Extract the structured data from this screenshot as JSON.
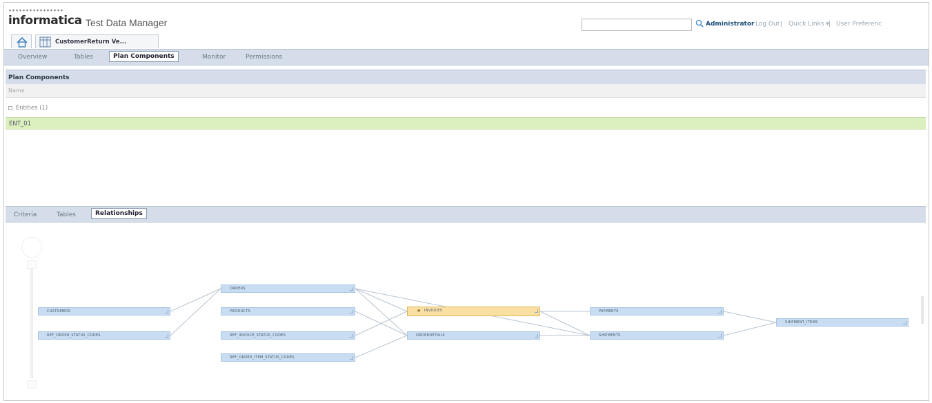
{
  "header": {
    "logo_text": "informatica",
    "product_name": "Test Data Manager",
    "search": {
      "value": "",
      "placeholder": ""
    },
    "user": "Administrator",
    "links": [
      "Log Out",
      "|",
      "Quick Links ▾",
      "|",
      "User Preferenc"
    ]
  },
  "object_tabs": {
    "home_icon": "home-icon",
    "document_tab": {
      "icon": "table-icon",
      "label": "CustomerReturn Ve..."
    }
  },
  "nav": {
    "tabs": [
      {
        "label": "Overview",
        "active": false
      },
      {
        "label": "Tables",
        "active": false
      },
      {
        "label": "Plan Components",
        "active": true
      },
      {
        "label": "Monitor",
        "active": false
      },
      {
        "label": "Permissions",
        "active": false
      }
    ]
  },
  "plan_components": {
    "title": "Plan Components",
    "column_header": "Name",
    "group_label": "Entities (1)",
    "rows": [
      "ENT_01"
    ]
  },
  "bottom_tabs": [
    {
      "label": "Criteria",
      "active": false
    },
    {
      "label": "Tables",
      "active": false
    },
    {
      "label": "Relationships",
      "active": true
    }
  ],
  "diagram": {
    "nodes": {
      "customers": "CUSTOMERS",
      "ref_order_status": "REF_ORDER_STATUS_CODES",
      "orders": "ORDERS",
      "products": "PRODUCTS",
      "ref_invoice_status": "REF_INVOICE_STATUS_CODES",
      "ref_order_item_status": "REF_ORDER_ITEM_STATUS_CODES",
      "invoices": "INVOICES",
      "orderdetails": "ORDERDETAILS",
      "payments": "PAYMENTS",
      "shipments": "SHIPMENTS",
      "shipment_items": "SHIPMENT_ITEMS"
    },
    "colors": {
      "node": "#c9ddf2",
      "highlight": "#fbe0a4",
      "link": "#b8c4d0"
    }
  }
}
